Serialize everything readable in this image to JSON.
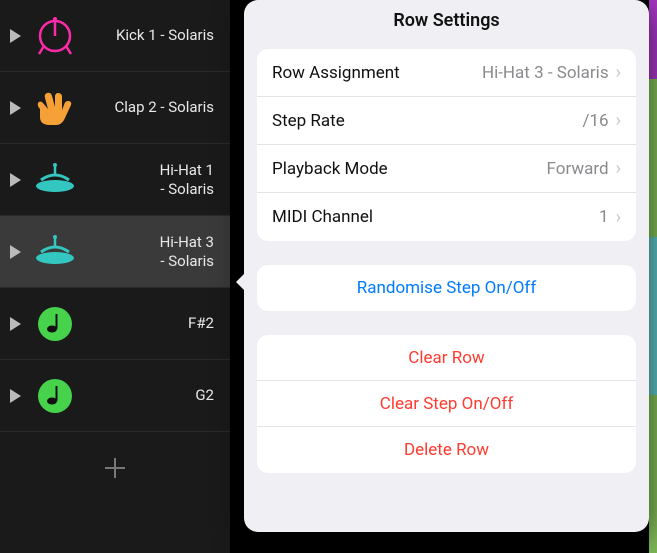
{
  "sidebar": {
    "tracks": [
      {
        "label": "Kick 1 - Solaris",
        "icon": "kick",
        "color": "#ff2aa9",
        "selected": false
      },
      {
        "label": "Clap 2 - Solaris",
        "icon": "clap",
        "color": "#f5a137",
        "selected": false
      },
      {
        "label": "Hi-Hat 1 - Solaris",
        "icon": "hihat",
        "color": "#34c6c0",
        "selected": false
      },
      {
        "label": "Hi-Hat 3 - Solaris",
        "icon": "hihat",
        "color": "#34c6c0",
        "selected": true
      },
      {
        "label": "F#2",
        "icon": "note",
        "color": "#46d24a",
        "selected": false
      },
      {
        "label": "G2",
        "icon": "note",
        "color": "#46d24a",
        "selected": false
      }
    ]
  },
  "popover": {
    "title": "Row Settings",
    "settings": [
      {
        "label": "Row Assignment",
        "value": "Hi-Hat 3 - Solaris"
      },
      {
        "label": "Step Rate",
        "value": "/16"
      },
      {
        "label": "Playback Mode",
        "value": "Forward"
      },
      {
        "label": "MIDI Channel",
        "value": "1"
      }
    ],
    "randomise": "Randomise Step On/Off",
    "destructive": [
      "Clear Row",
      "Clear Step On/Off",
      "Delete Row"
    ]
  }
}
